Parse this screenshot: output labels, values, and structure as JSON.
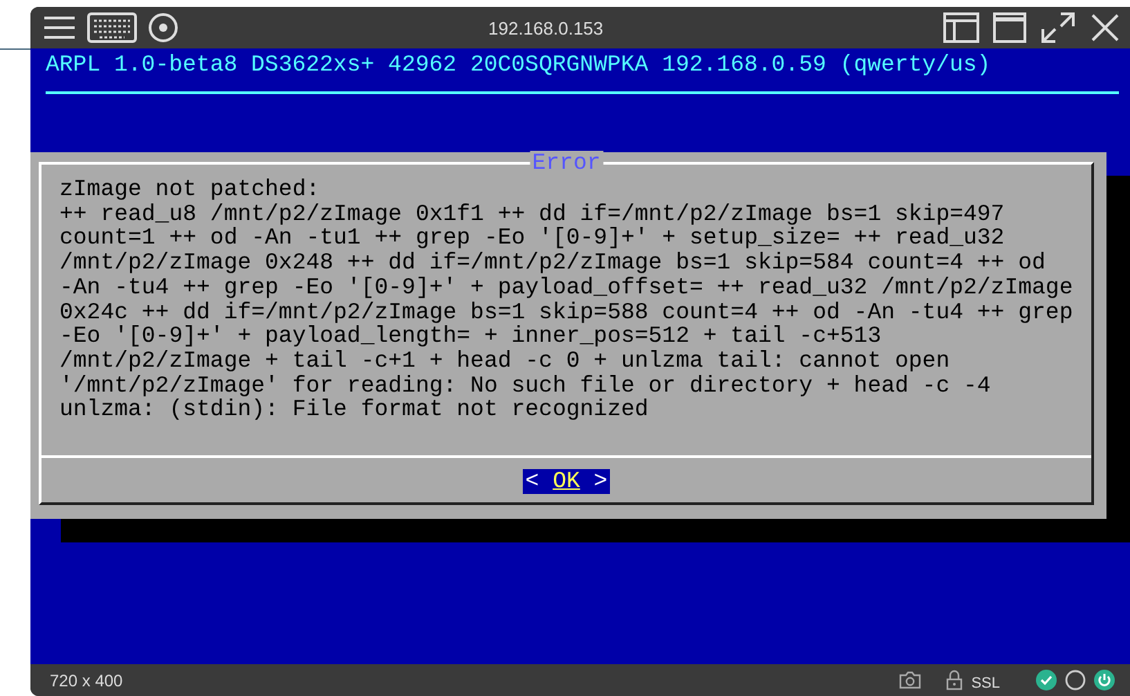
{
  "window": {
    "title": "192.168.0.153"
  },
  "console": {
    "header": "ARPL 1.0-beta8 DS3622xs+ 42962 20C0SQRGNWPKA 192.168.0.59 (qwerty/us)"
  },
  "dialog": {
    "title": "Error",
    "lines": [
      "zImage not patched:",
      "++ read_u8 /mnt/p2/zImage 0x1f1 ++ dd if=/mnt/p2/zImage bs=1 skip=497",
      "count=1 ++ od -An -tu1 ++ grep -Eo '[0-9]+' + setup_size= ++ read_u32",
      "/mnt/p2/zImage 0x248 ++ dd if=/mnt/p2/zImage bs=1 skip=584 count=4 ++ od",
      "-An -tu4 ++ grep -Eo '[0-9]+' + payload_offset= ++ read_u32 /mnt/p2/zImage",
      "0x24c ++ dd if=/mnt/p2/zImage bs=1 skip=588 count=4 ++ od -An -tu4 ++ grep",
      "-Eo '[0-9]+' + payload_length= + inner_pos=512 + tail -c+513",
      "/mnt/p2/zImage + tail -c+1 + head -c 0 + unlzma tail: cannot open",
      "'/mnt/p2/zImage' for reading: No such file or directory + head -c -4",
      "unlzma: (stdin): File format not recognized"
    ],
    "buttons": [
      {
        "left": "<",
        "label": "OK",
        "right": ">",
        "selected": true
      }
    ]
  },
  "status_bar": {
    "resolution": "720 x 400",
    "security": "SSL"
  }
}
